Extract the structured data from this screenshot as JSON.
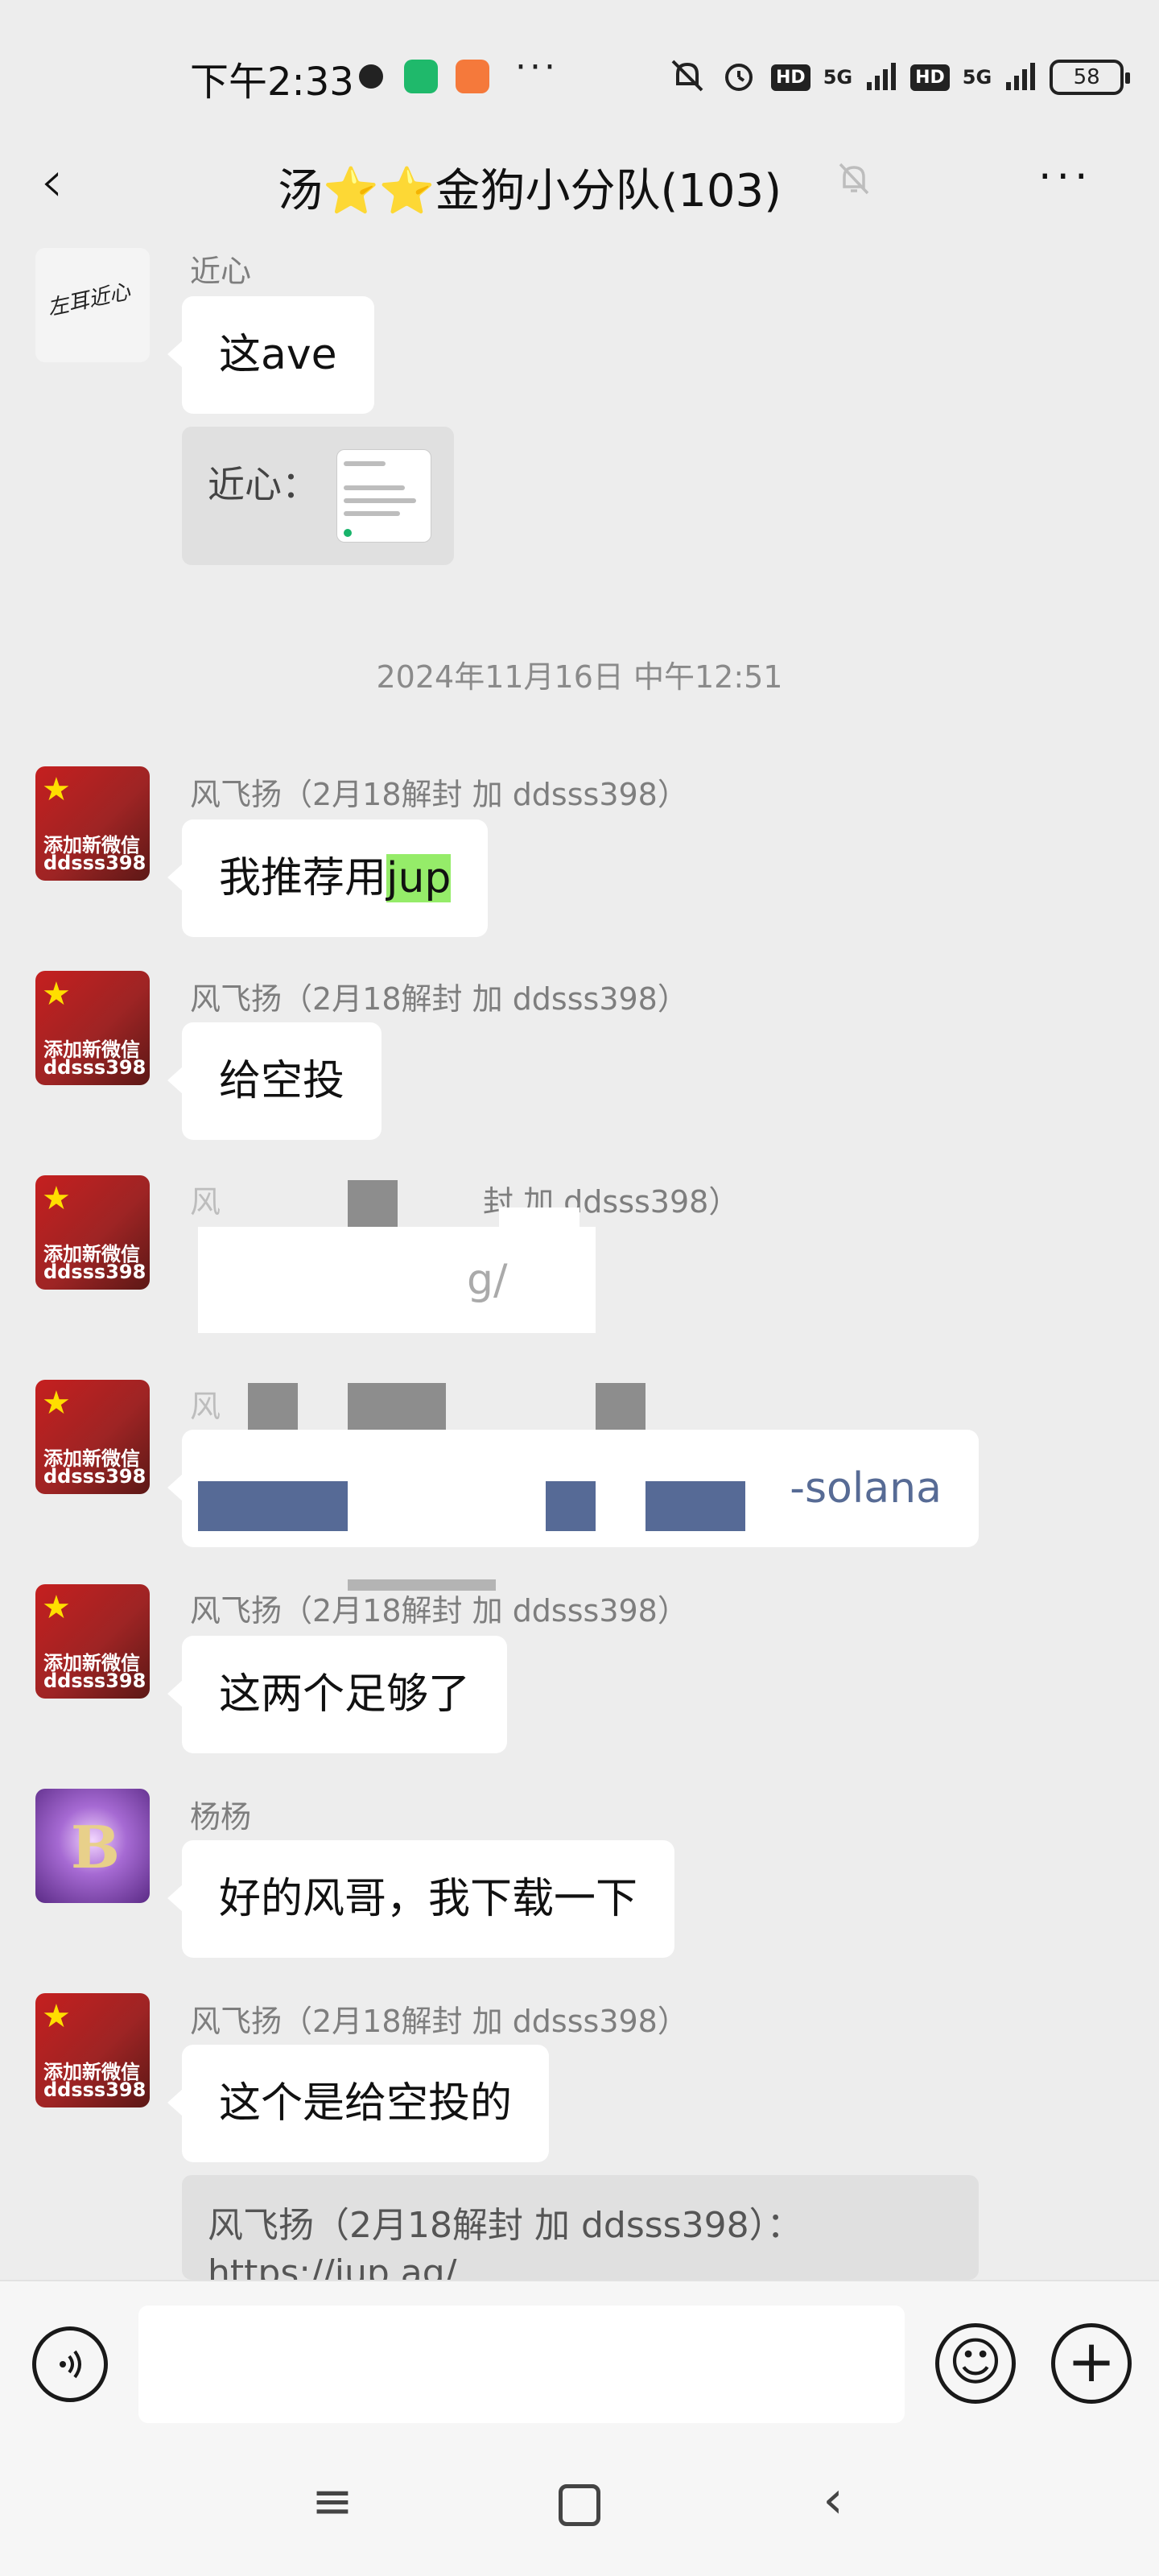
{
  "status_bar": {
    "time": "下午2:33",
    "more": "···",
    "hd": "HD",
    "network": "5G",
    "battery": "58"
  },
  "header": {
    "back": "‹",
    "title": "汤⭐⭐金狗小分队(103)",
    "mute_icon": "bell-off-icon",
    "more": "···"
  },
  "avatars": {
    "red_line1": "添加新微信",
    "red_line2": "ddsss398",
    "signature": "左耳近心",
    "purple_letter": "B"
  },
  "messages": [
    {
      "sender": "近心",
      "text": "这ave"
    },
    {
      "quote_prefix": "近心："
    },
    {
      "sender": "风飞扬（2月18解封 加 ddsss398）",
      "text_before": "我推荐用",
      "text_highlight": "jup"
    },
    {
      "sender": "风飞扬（2月18解封 加 ddsss398）",
      "text": "给空投"
    },
    {
      "sender_fragment_start": "风",
      "sender_fragment_end": "封 加 ddsss398）",
      "text_fragment": "g/"
    },
    {
      "sender_fragment_start": "风",
      "text_fragment": "-solana"
    },
    {
      "sender": "风飞扬（2月18解封 加 ddsss398）",
      "text": "这两个足够了"
    },
    {
      "sender": "杨杨",
      "text": "好的风哥，我下载一下"
    },
    {
      "sender": "风飞扬（2月18解封 加 ddsss398）",
      "text": "这个是给空投的"
    },
    {
      "quote_line1": "风飞扬（2月18解封 加 ddsss398）：",
      "quote_line2": "https://jup.ag/"
    }
  ],
  "timestamp": "2024年11月16日 中午12:51",
  "input_bar": {
    "voice_icon": "voice-icon",
    "emoji": "☺",
    "plus": "+"
  },
  "nav_bar": {
    "menu": "≡",
    "back": "‹"
  },
  "colors": {
    "background": "#ededed",
    "bubble": "#ffffff",
    "highlight": "#95ec69",
    "sender": "#7e7e7e"
  }
}
